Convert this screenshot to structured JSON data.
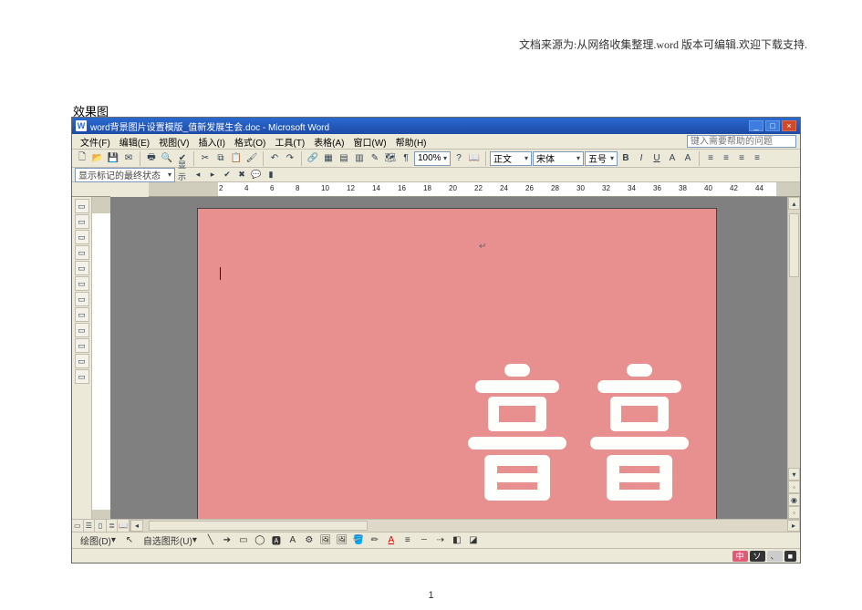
{
  "doc_header": "文档来源为:从网络收集整理.word 版本可编辑.欢迎下载支持.",
  "section_title": "效果图",
  "page_footer_num": "1",
  "titlebar": {
    "icon_label": "W",
    "title": "word背景图片设置模版_值新发展生会.doc - Microsoft Word",
    "btn_min": "_",
    "btn_max": "□",
    "btn_close": "×"
  },
  "menus": [
    "文件(F)",
    "编辑(E)",
    "视图(V)",
    "插入(I)",
    "格式(O)",
    "工具(T)",
    "表格(A)",
    "窗口(W)",
    "帮助(H)"
  ],
  "help_placeholder": "键入需要帮助的问题",
  "toolbar1": {
    "zoom": "100%",
    "style": "正文",
    "font": "宋体",
    "size": "五号"
  },
  "outlinebar_label": "显示标记的最终状态",
  "outlinebar_btn": "显示(S)",
  "ruler_numbers": [
    "2",
    "4",
    "6",
    "8",
    "10",
    "12",
    "14",
    "16",
    "18",
    "20",
    "22",
    "24",
    "26",
    "28",
    "30",
    "32",
    "34",
    "36",
    "38",
    "40",
    "42",
    "44"
  ],
  "canvas": {
    "bg_color": "#e88f90",
    "xi_label": "喜",
    "xi_color": "#fffffb"
  },
  "drawbar": {
    "label_draw": "绘图(D)",
    "label_autoshape": "自选图形(U)"
  },
  "status": {
    "lang1": "中",
    "lang2": "ソ",
    "lang3": "、",
    "lang4": "■"
  }
}
